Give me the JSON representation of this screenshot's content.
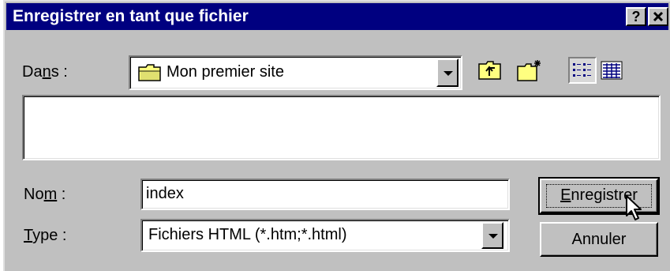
{
  "window": {
    "title": "Enregistrer en tant que fichier",
    "help_button": "?",
    "close_button": "×"
  },
  "location": {
    "label_pre": "Da",
    "label_mnemonic": "n",
    "label_post": "s :",
    "value": "Mon premier site",
    "folder_icon": "folder-icon"
  },
  "toolbar": {
    "up_folder_icon": "up-one-level-icon",
    "new_folder_icon": "new-folder-icon",
    "list_view_icon": "list-view-icon",
    "details_view_icon": "details-view-icon"
  },
  "filename": {
    "label_pre": "No",
    "label_mnemonic": "m",
    "label_post": " :",
    "value": "index"
  },
  "filetype": {
    "label_mnemonic": "T",
    "label_post": "ype :",
    "value": "Fichiers HTML (*.htm;*.html)"
  },
  "buttons": {
    "save_mnemonic": "E",
    "save_rest": "nregistrer",
    "cancel": "Annuler"
  },
  "colors": {
    "titlebar": "#000080",
    "face": "#c0c0c0",
    "field": "#ffffff"
  }
}
